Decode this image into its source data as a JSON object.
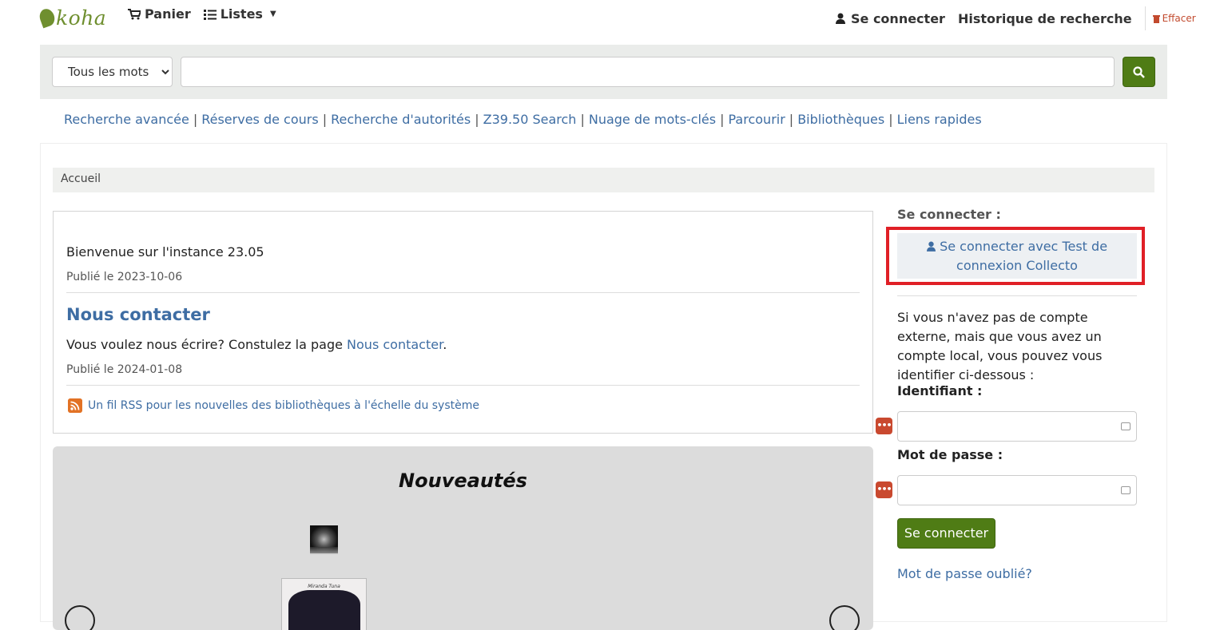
{
  "header": {
    "logo": "koha",
    "cart": "Panier",
    "lists": "Listes",
    "login": "Se connecter",
    "history": "Historique de recherche",
    "clear": "Effacer"
  },
  "search": {
    "scope_selected": "Tous les mots",
    "query_value": "",
    "submit_icon": "search-icon"
  },
  "links": [
    "Recherche avancée",
    "Réserves de cours",
    "Recherche d'autorités",
    "Z39.50 Search",
    "Nuage de mots-clés",
    "Parcourir",
    "Bibliothèques",
    "Liens rapides"
  ],
  "breadcrumb": "Accueil",
  "news": {
    "item1_title": "Bienvenue sur l'instance 23.05",
    "item1_published": "Publié le 2023-10-06",
    "item2_title": "Nous contacter",
    "item2_body_prefix": "Vous voulez nous écrire? Constulez la page ",
    "item2_body_link": "Nous contacter",
    "item2_body_suffix": ".",
    "item2_published": "Publié le 2024-01-08",
    "rss": "Un fil RSS pour les nouvelles des bibliothèques à l'échelle du système"
  },
  "carousel": {
    "title": "Nouveautés",
    "book_cover_text": "Miranda Tuna"
  },
  "login": {
    "heading": "Se connecter :",
    "external_button": "Se connecter avec Test de connexion Collecto",
    "info": "Si vous n'avez pas de compte externe, mais que vous avez un compte local, vous pouvez vous identifier ci-dessous :",
    "username_label": "Identifiant :",
    "password_label": "Mot de passe :",
    "submit": "Se connecter",
    "forgot": "Mot de passe oublié?"
  },
  "colors": {
    "brand_green": "#4f7c15",
    "link_blue": "#3e6da3",
    "highlight_red": "#e01f26"
  }
}
